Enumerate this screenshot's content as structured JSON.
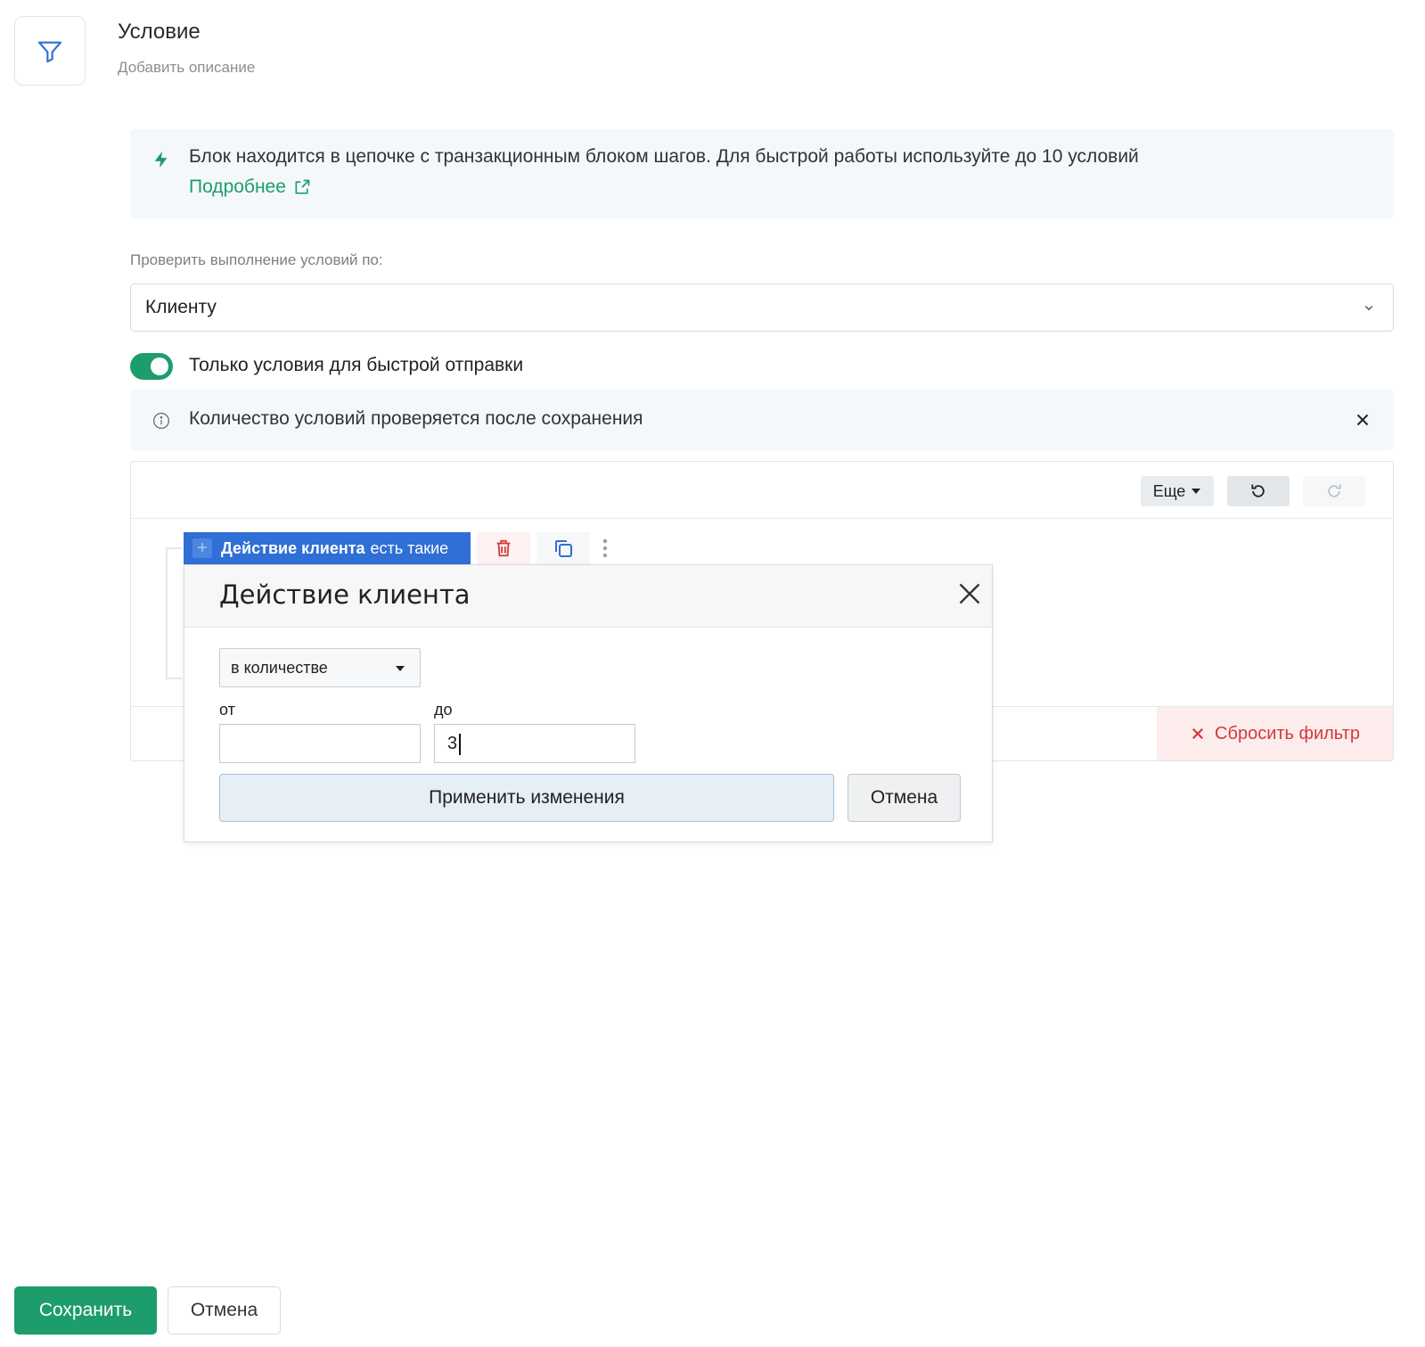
{
  "header": {
    "title": "Условие",
    "description": "Добавить описание"
  },
  "banner": {
    "text": "Блок находится в цепочке с транзакционным блоком шагов. Для быстрой работы используйте до 10 условий",
    "link": "Подробнее"
  },
  "check": {
    "label": "Проверить выполнение условий по:",
    "selected": "Клиенту"
  },
  "toggle": {
    "label": "Только условия для быстрой отправки",
    "on": true
  },
  "info": {
    "text": "Количество условий проверяется после сохранения"
  },
  "builder": {
    "more_label": "Еще",
    "reset_label": "Сбросить фильтр",
    "chip": {
      "label": "Действие клиента",
      "modifier": "есть такие"
    }
  },
  "popup": {
    "title": "Действие клиента",
    "mode": "в количестве",
    "from_label": "от",
    "to_label": "до",
    "from_value": "",
    "to_value": "3",
    "apply_label": "Применить изменения",
    "cancel_label": "Отмена"
  },
  "footer": {
    "save_label": "Сохранить",
    "cancel_label": "Отмена"
  },
  "colors": {
    "accent": "#1d9c6c",
    "chip": "#2f6fd6",
    "danger": "#d23a3a"
  }
}
